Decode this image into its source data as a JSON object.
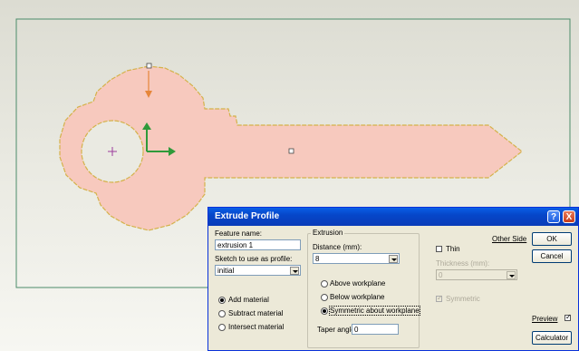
{
  "dialog": {
    "title": "Extrude Profile",
    "feature_name_label": "Feature name:",
    "feature_name_value": "extrusion 1",
    "sketch_label": "Sketch to use as profile:",
    "sketch_value": "initial",
    "material_options": [
      "Add material",
      "Subtract material",
      "Intersect material"
    ],
    "material_selected": "Add material",
    "extrusion_group_label": "Extrusion",
    "distance_label": "Distance (mm):",
    "distance_value": "8",
    "direction_options": [
      "Above workplane",
      "Below workplane",
      "Symmetric about workplane"
    ],
    "direction_selected": "Symmetric about workplane",
    "taper_label": "Taper angle:",
    "taper_value": "0",
    "thin_label": "Thin",
    "other_side_label": "Other Side",
    "thickness_label": "Thickness (mm):",
    "thickness_value": "0",
    "symmetric_label": "Symmetric",
    "ok_label": "OK",
    "cancel_label": "Cancel",
    "preview_label": "Preview",
    "calculator_label": "Calculator"
  },
  "icons": {
    "help": "?",
    "close": "X"
  },
  "colors": {
    "profile_fill": "#f7c9be",
    "profile_edge": "#d4b24a",
    "title_bar": "#0a52d6",
    "workplane_border": "#4c8c6a",
    "axis_green": "#2f9a3a",
    "axis_orange": "#e6863a"
  }
}
